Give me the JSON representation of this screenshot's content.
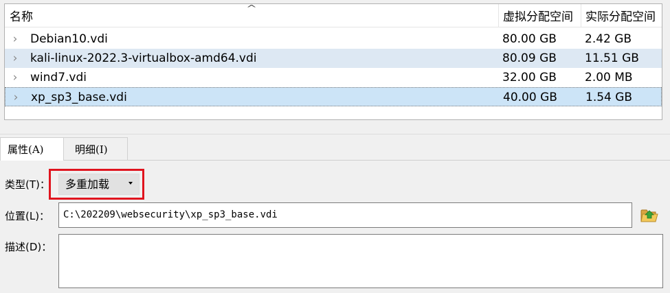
{
  "table": {
    "headers": {
      "name": "名称",
      "virtual_size": "虚拟分配空间",
      "actual_size": "实际分配空间"
    },
    "rows": [
      {
        "name": "Debian10.vdi",
        "virtual_size": "80.00 GB",
        "actual_size": "2.42 GB"
      },
      {
        "name": "kali-linux-2022.3-virtualbox-amd64.vdi",
        "virtual_size": "80.09 GB",
        "actual_size": "11.51 GB"
      },
      {
        "name": "wind7.vdi",
        "virtual_size": "32.00 GB",
        "actual_size": "2.00 MB"
      },
      {
        "name": "xp_sp3_base.vdi",
        "virtual_size": "40.00 GB",
        "actual_size": "1.54 GB"
      }
    ],
    "selected_index": 3
  },
  "tabs": [
    {
      "label": "属性(A)",
      "active": true
    },
    {
      "label": "明细(I)",
      "active": false
    }
  ],
  "properties": {
    "type_label": "类型(T)：",
    "type_value": "多重加载",
    "location_label": "位置(L)：",
    "location_value": "C:\\202209\\websecurity\\xp_sp3_base.vdi",
    "description_label": "描述(D)：",
    "description_value": ""
  },
  "colors": {
    "highlight_border": "#e0141e",
    "selected_row": "#cce4f7",
    "alt_row": "#dde8f3"
  },
  "icons": {
    "sort": "sort-up-icon",
    "expand": "chevron-right-icon",
    "folder": "folder-open-icon"
  }
}
